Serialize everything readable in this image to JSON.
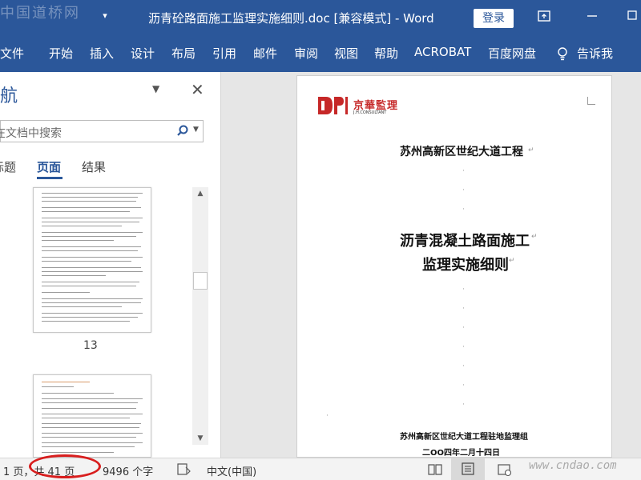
{
  "window": {
    "watermark_logo": "中国道桥网",
    "title": "沥青砼路面施工监理实施细则.doc [兼容模式] - Word",
    "login_label": "登录"
  },
  "ribbon": {
    "tabs": [
      "文件",
      "开始",
      "插入",
      "设计",
      "布局",
      "引用",
      "邮件",
      "审阅",
      "视图",
      "帮助",
      "ACROBAT",
      "百度网盘"
    ],
    "tell_me": "告诉我"
  },
  "navigation": {
    "title": "导航",
    "search_placeholder": "在文档中搜索",
    "tabs": [
      "标题",
      "页面",
      "结果"
    ],
    "active_tab": "页面",
    "thumbnail_page_number": "13"
  },
  "document": {
    "logo_cn": "京華監理",
    "logo_en": "J.H.CONSULTANT",
    "project_name": "苏州高新区世纪大道工程",
    "title_line1": "沥青混凝土路面施工",
    "title_line2": "监理实施细则",
    "organization": "苏州高新区世纪大道工程驻地监理组",
    "date": "二OO四年二月十四日"
  },
  "statusbar": {
    "page_info": "1 页，共 41 页",
    "word_count": "9496 个字",
    "language": "中文(中国)",
    "watermark_site": "www.cndao.com"
  },
  "colors": {
    "word_blue": "#2b579a",
    "highlight_red": "#d81e1e"
  }
}
